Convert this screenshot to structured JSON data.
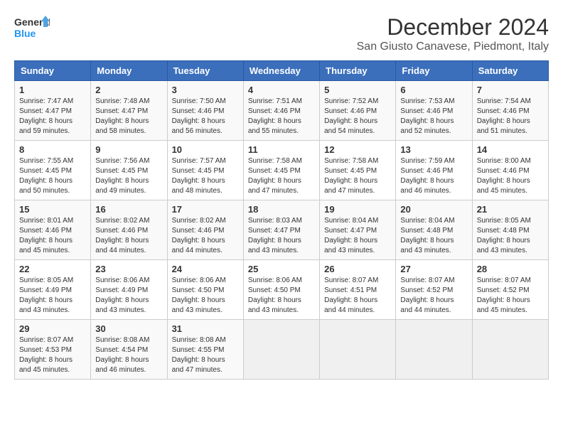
{
  "logo": {
    "line1": "General",
    "line2": "Blue"
  },
  "title": "December 2024",
  "subtitle": "San Giusto Canavese, Piedmont, Italy",
  "headers": [
    "Sunday",
    "Monday",
    "Tuesday",
    "Wednesday",
    "Thursday",
    "Friday",
    "Saturday"
  ],
  "weeks": [
    [
      {
        "day": "1",
        "sunrise": "7:47 AM",
        "sunset": "4:47 PM",
        "daylight": "8 hours and 59 minutes."
      },
      {
        "day": "2",
        "sunrise": "7:48 AM",
        "sunset": "4:47 PM",
        "daylight": "8 hours and 58 minutes."
      },
      {
        "day": "3",
        "sunrise": "7:50 AM",
        "sunset": "4:46 PM",
        "daylight": "8 hours and 56 minutes."
      },
      {
        "day": "4",
        "sunrise": "7:51 AM",
        "sunset": "4:46 PM",
        "daylight": "8 hours and 55 minutes."
      },
      {
        "day": "5",
        "sunrise": "7:52 AM",
        "sunset": "4:46 PM",
        "daylight": "8 hours and 54 minutes."
      },
      {
        "day": "6",
        "sunrise": "7:53 AM",
        "sunset": "4:46 PM",
        "daylight": "8 hours and 52 minutes."
      },
      {
        "day": "7",
        "sunrise": "7:54 AM",
        "sunset": "4:46 PM",
        "daylight": "8 hours and 51 minutes."
      }
    ],
    [
      {
        "day": "8",
        "sunrise": "7:55 AM",
        "sunset": "4:45 PM",
        "daylight": "8 hours and 50 minutes."
      },
      {
        "day": "9",
        "sunrise": "7:56 AM",
        "sunset": "4:45 PM",
        "daylight": "8 hours and 49 minutes."
      },
      {
        "day": "10",
        "sunrise": "7:57 AM",
        "sunset": "4:45 PM",
        "daylight": "8 hours and 48 minutes."
      },
      {
        "day": "11",
        "sunrise": "7:58 AM",
        "sunset": "4:45 PM",
        "daylight": "8 hours and 47 minutes."
      },
      {
        "day": "12",
        "sunrise": "7:58 AM",
        "sunset": "4:45 PM",
        "daylight": "8 hours and 47 minutes."
      },
      {
        "day": "13",
        "sunrise": "7:59 AM",
        "sunset": "4:46 PM",
        "daylight": "8 hours and 46 minutes."
      },
      {
        "day": "14",
        "sunrise": "8:00 AM",
        "sunset": "4:46 PM",
        "daylight": "8 hours and 45 minutes."
      }
    ],
    [
      {
        "day": "15",
        "sunrise": "8:01 AM",
        "sunset": "4:46 PM",
        "daylight": "8 hours and 45 minutes."
      },
      {
        "day": "16",
        "sunrise": "8:02 AM",
        "sunset": "4:46 PM",
        "daylight": "8 hours and 44 minutes."
      },
      {
        "day": "17",
        "sunrise": "8:02 AM",
        "sunset": "4:46 PM",
        "daylight": "8 hours and 44 minutes."
      },
      {
        "day": "18",
        "sunrise": "8:03 AM",
        "sunset": "4:47 PM",
        "daylight": "8 hours and 43 minutes."
      },
      {
        "day": "19",
        "sunrise": "8:04 AM",
        "sunset": "4:47 PM",
        "daylight": "8 hours and 43 minutes."
      },
      {
        "day": "20",
        "sunrise": "8:04 AM",
        "sunset": "4:48 PM",
        "daylight": "8 hours and 43 minutes."
      },
      {
        "day": "21",
        "sunrise": "8:05 AM",
        "sunset": "4:48 PM",
        "daylight": "8 hours and 43 minutes."
      }
    ],
    [
      {
        "day": "22",
        "sunrise": "8:05 AM",
        "sunset": "4:49 PM",
        "daylight": "8 hours and 43 minutes."
      },
      {
        "day": "23",
        "sunrise": "8:06 AM",
        "sunset": "4:49 PM",
        "daylight": "8 hours and 43 minutes."
      },
      {
        "day": "24",
        "sunrise": "8:06 AM",
        "sunset": "4:50 PM",
        "daylight": "8 hours and 43 minutes."
      },
      {
        "day": "25",
        "sunrise": "8:06 AM",
        "sunset": "4:50 PM",
        "daylight": "8 hours and 43 minutes."
      },
      {
        "day": "26",
        "sunrise": "8:07 AM",
        "sunset": "4:51 PM",
        "daylight": "8 hours and 44 minutes."
      },
      {
        "day": "27",
        "sunrise": "8:07 AM",
        "sunset": "4:52 PM",
        "daylight": "8 hours and 44 minutes."
      },
      {
        "day": "28",
        "sunrise": "8:07 AM",
        "sunset": "4:52 PM",
        "daylight": "8 hours and 45 minutes."
      }
    ],
    [
      {
        "day": "29",
        "sunrise": "8:07 AM",
        "sunset": "4:53 PM",
        "daylight": "8 hours and 45 minutes."
      },
      {
        "day": "30",
        "sunrise": "8:08 AM",
        "sunset": "4:54 PM",
        "daylight": "8 hours and 46 minutes."
      },
      {
        "day": "31",
        "sunrise": "8:08 AM",
        "sunset": "4:55 PM",
        "daylight": "8 hours and 47 minutes."
      },
      null,
      null,
      null,
      null
    ]
  ]
}
